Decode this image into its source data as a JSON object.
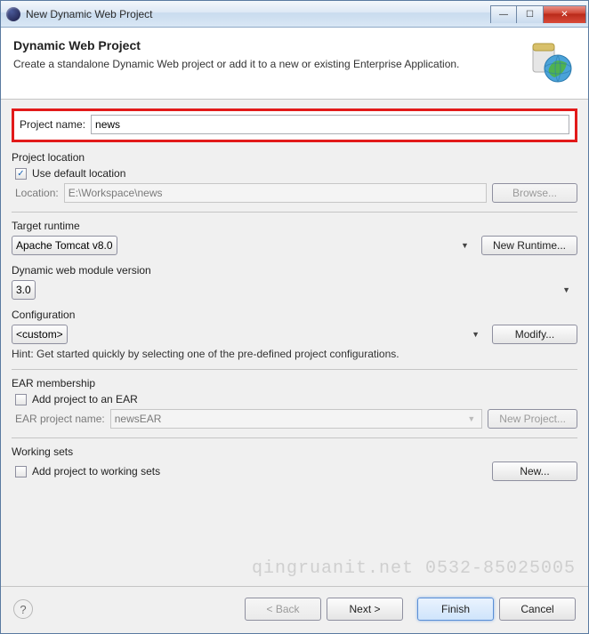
{
  "window": {
    "title": "New Dynamic Web Project"
  },
  "banner": {
    "heading": "Dynamic Web Project",
    "description": "Create a standalone Dynamic Web project or add it to a new or existing Enterprise Application."
  },
  "project_name": {
    "label": "Project name:",
    "value": "news"
  },
  "project_location": {
    "group_title": "Project location",
    "use_default_label": "Use default location",
    "use_default_checked": true,
    "location_label": "Location:",
    "location_value": "E:\\Workspace\\news",
    "browse_label": "Browse..."
  },
  "target_runtime": {
    "group_title": "Target runtime",
    "value": "Apache Tomcat v8.0",
    "new_runtime_label": "New Runtime..."
  },
  "module_version": {
    "group_title": "Dynamic web module version",
    "value": "3.0"
  },
  "configuration": {
    "group_title": "Configuration",
    "value": "<custom>",
    "modify_label": "Modify...",
    "hint": "Hint: Get started quickly by selecting one of the pre-defined project configurations."
  },
  "ear": {
    "group_title": "EAR membership",
    "add_label": "Add project to an EAR",
    "add_checked": false,
    "name_label": "EAR project name:",
    "name_value": "newsEAR",
    "new_project_label": "New Project..."
  },
  "working_sets": {
    "group_title": "Working sets",
    "add_label": "Add project to working sets",
    "add_checked": false,
    "new_label": "New..."
  },
  "footer": {
    "back": "< Back",
    "next": "Next >",
    "finish": "Finish",
    "cancel": "Cancel"
  },
  "watermark": "qingruanit.net 0532-85025005"
}
